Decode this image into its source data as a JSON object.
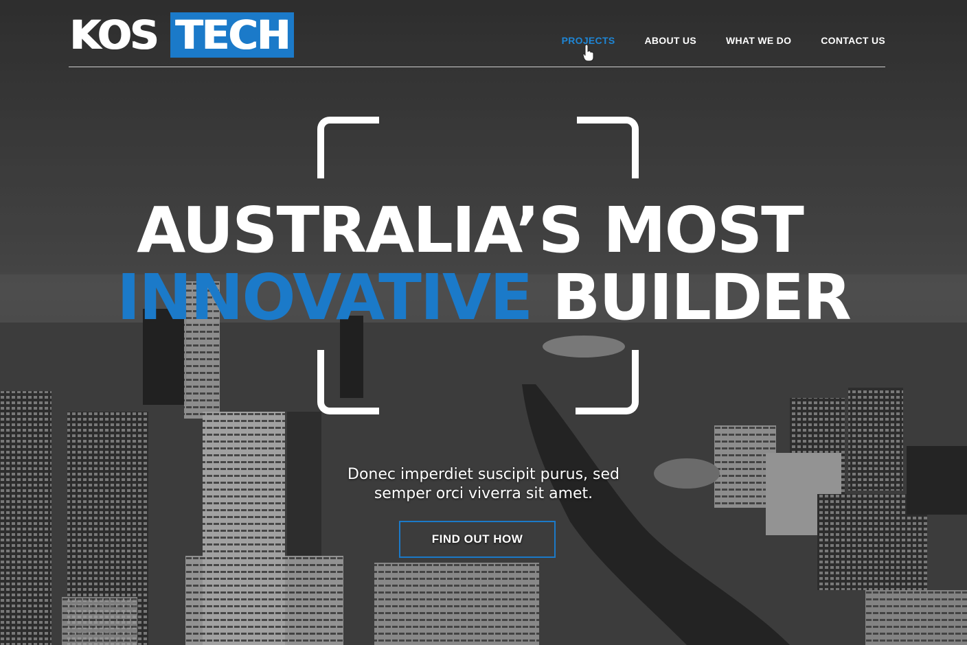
{
  "brand": {
    "logo_left": "KOS",
    "logo_right": "TECH",
    "accent_color": "#1b7ac9"
  },
  "nav": {
    "items": [
      {
        "label": "PROJECTS",
        "active": true
      },
      {
        "label": "ABOUT US",
        "active": false
      },
      {
        "label": "WHAT WE DO",
        "active": false
      },
      {
        "label": "CONTACT US",
        "active": false
      }
    ]
  },
  "hero": {
    "headline_line1": "AUSTRALIA’S MOST",
    "headline_accent": "INNOVATIVE",
    "headline_rest": "BUILDER",
    "subtitle_line1": "Donec imperdiet suscipit purus, sed",
    "subtitle_line2": "semper orci viverra sit amet.",
    "cta_label": "FIND OUT HOW",
    "background_image": "aerial city skyline (grayscale)"
  }
}
